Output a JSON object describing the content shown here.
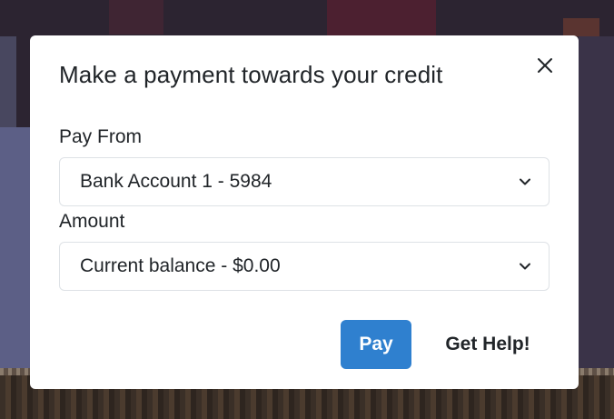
{
  "modal": {
    "title": "Make a payment towards your credit",
    "close_icon": "close-icon",
    "pay_from": {
      "label": "Pay From",
      "selected": "Bank Account 1 - 5984",
      "icon": "chevron-down-icon"
    },
    "amount": {
      "label": "Amount",
      "selected": "Current balance - $0.00",
      "icon": "chevron-down-icon"
    },
    "pay_button": "Pay",
    "help_button": "Get Help!"
  },
  "colors": {
    "primary": "#2f80cf",
    "text": "#212529",
    "border": "#dee2e6"
  }
}
